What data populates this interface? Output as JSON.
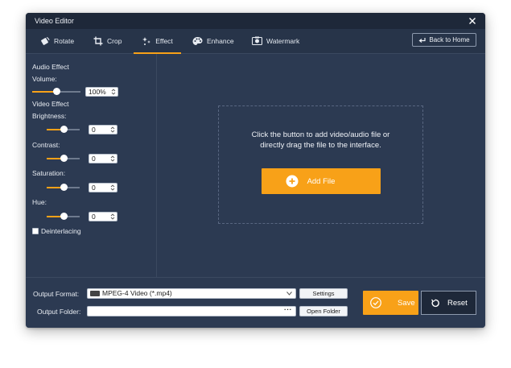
{
  "window": {
    "title": "Video Editor"
  },
  "tabs": [
    {
      "label": "Rotate",
      "icon": "rotate-icon"
    },
    {
      "label": "Crop",
      "icon": "crop-icon"
    },
    {
      "label": "Effect",
      "icon": "effect-icon",
      "active": true
    },
    {
      "label": "Enhance",
      "icon": "enhance-icon"
    },
    {
      "label": "Watermark",
      "icon": "watermark-icon"
    }
  ],
  "back_home": {
    "label": "Back to Home"
  },
  "audio_effect": {
    "heading": "Audio Effect",
    "volume": {
      "label": "Volume:",
      "value": "100%",
      "level": 0.5
    }
  },
  "video_effect": {
    "heading": "Video Effect",
    "brightness": {
      "label": "Brightness:",
      "value": "0",
      "level": 0.5
    },
    "contrast": {
      "label": "Contrast:",
      "value": "0",
      "level": 0.5
    },
    "saturation": {
      "label": "Saturation:",
      "value": "0",
      "level": 0.5
    },
    "hue": {
      "label": "Hue:",
      "value": "0",
      "level": 0.5
    },
    "deinterlacing": {
      "label": "Deinterlacing",
      "checked": false
    }
  },
  "drop_zone": {
    "line1": "Click the button to add video/audio file or",
    "line2": "directly drag the file to the interface.",
    "add_file_label": "Add File"
  },
  "output": {
    "format_label": "Output Format:",
    "format_value": "MPEG-4 Video (*.mp4)",
    "settings_label": "Settings",
    "folder_label": "Output Folder:",
    "folder_value": "",
    "open_folder_label": "Open Folder"
  },
  "actions": {
    "save_label": "Save",
    "reset_label": "Reset"
  },
  "colors": {
    "accent": "#f8a118",
    "background": "#2c3a52",
    "titlebar": "#1e2839"
  }
}
